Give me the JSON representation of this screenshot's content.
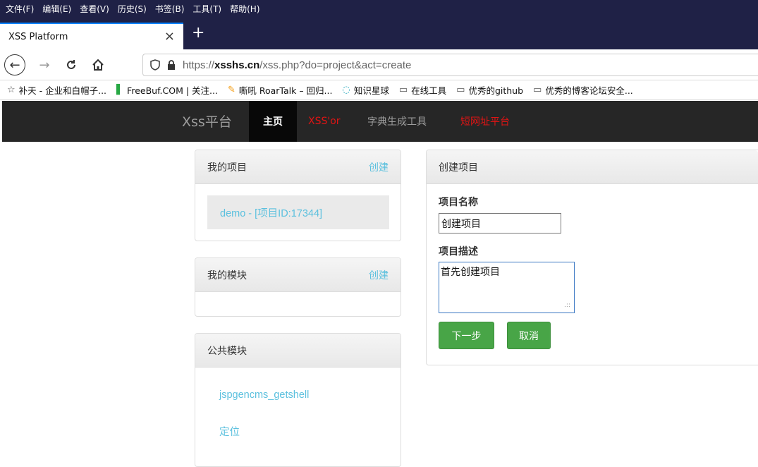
{
  "menubar": [
    "文件(F)",
    "编辑(E)",
    "查看(V)",
    "历史(S)",
    "书签(B)",
    "工具(T)",
    "帮助(H)"
  ],
  "tab": {
    "title": "XSS Platform",
    "close": "×",
    "new_tab": "+"
  },
  "nav": {
    "back": "←",
    "forward": "→",
    "reload": "C",
    "home": "⌂"
  },
  "url": {
    "prefix": "https://",
    "domain": "xsshs.cn",
    "path": "/xss.php?do=project&act=create"
  },
  "bookmarks": [
    {
      "icon": "☆",
      "label": "补天 - 企业和白帽子...",
      "style": ""
    },
    {
      "icon": "▌",
      "label": "FreeBuf.COM | 关注...",
      "style": "green"
    },
    {
      "icon": "✎",
      "label": "嘶吼 RoarTalk – 回归...",
      "style": "orange"
    },
    {
      "icon": "◌",
      "label": "知识星球",
      "style": "cyan"
    },
    {
      "icon": "▭",
      "label": "在线工具",
      "style": ""
    },
    {
      "icon": "▭",
      "label": "优秀的github",
      "style": ""
    },
    {
      "icon": "▭",
      "label": "优秀的博客论坛安全...",
      "style": ""
    }
  ],
  "site": {
    "brand": "Xss平台",
    "nav": {
      "home": "主页",
      "xssor": "XSS'or",
      "dict": "字典生成工具",
      "short": "短网址平台"
    }
  },
  "my_projects": {
    "title": "我的项目",
    "create": "创建",
    "items": [
      "demo - [项目ID:17344]"
    ]
  },
  "my_modules": {
    "title": "我的模块",
    "create": "创建"
  },
  "public_modules": {
    "title": "公共模块",
    "items": [
      "jspgencms_getshell",
      "定位"
    ]
  },
  "create_project": {
    "title": "创建项目",
    "name_label": "项目名称",
    "name_value": "创建项目",
    "desc_label": "项目描述",
    "desc_value": "首先创建项目",
    "next": "下一步",
    "cancel": "取消"
  },
  "colors": {
    "link": "#5bc0de",
    "btn_green": "#48a547",
    "nav_red": "#e01414",
    "header_bg": "#262626"
  }
}
